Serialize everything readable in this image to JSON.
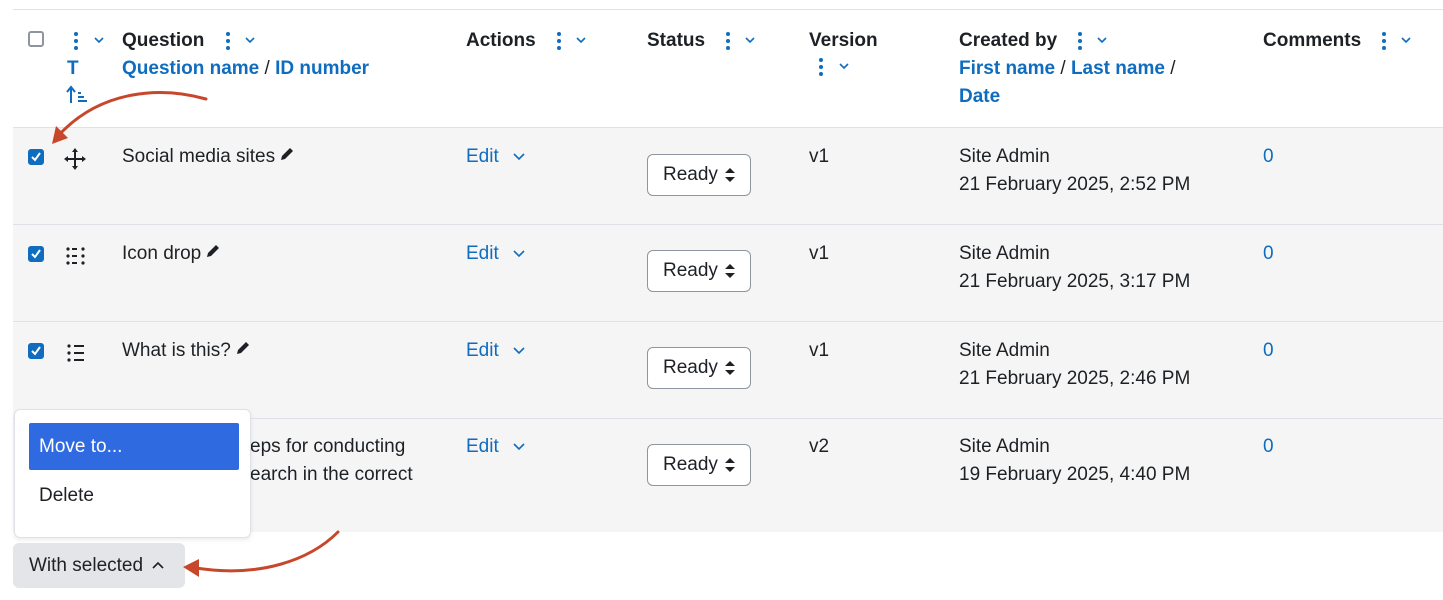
{
  "header": {
    "type_sort": "T",
    "question_label": "Question",
    "question_name_link": "Question name",
    "id_number_link": "ID number",
    "actions_label": "Actions",
    "status_label": "Status",
    "version_label": "Version",
    "created_by_label": "Created by",
    "first_name_link": "First name",
    "last_name_link": "Last name",
    "date_link": "Date",
    "comments_label": "Comments",
    "separator": "/"
  },
  "rows": [
    {
      "name": "Social media sites",
      "action": "Edit",
      "status": "Ready",
      "version": "v1",
      "creator": "Site Admin",
      "date": "21 February 2025, 2:52 PM",
      "comments": "0",
      "checked": true,
      "type_icon": "move-icon"
    },
    {
      "name": "Icon drop",
      "action": "Edit",
      "status": "Ready",
      "version": "v1",
      "creator": "Site Admin",
      "date": "21 February 2025, 3:17 PM",
      "comments": "0",
      "checked": true,
      "type_icon": "grid-dots-icon"
    },
    {
      "name": "What is this?",
      "action": "Edit",
      "status": "Ready",
      "version": "v1",
      "creator": "Site Admin",
      "date": "21 February 2025, 2:46 PM",
      "comments": "0",
      "checked": true,
      "type_icon": "list-icon"
    },
    {
      "name_line1": "eps for conducting",
      "name_line2": "earch in the correct",
      "action": "Edit",
      "status": "Ready",
      "version": "v2",
      "creator": "Site Admin",
      "date": "19 February 2025, 4:40 PM",
      "comments": "0",
      "checked": true
    }
  ],
  "bulk_menu": {
    "move_label": "Move to...",
    "delete_label": "Delete",
    "button_label": "With selected"
  },
  "colors": {
    "link": "#0f6cbf",
    "active_item": "#2f6ae0",
    "annotation_arrow": "#c8472b"
  }
}
